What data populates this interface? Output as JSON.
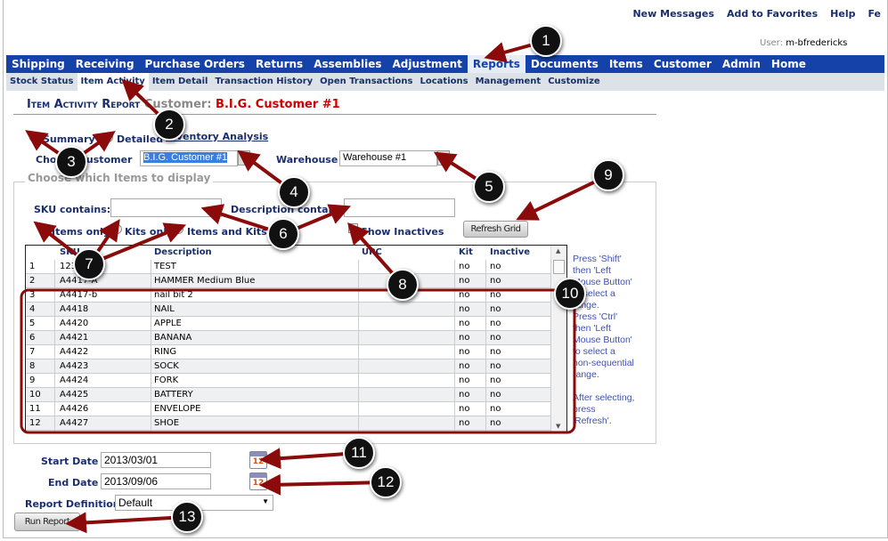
{
  "top_links": [
    "New Messages",
    "Add to Favorites",
    "Help",
    "Fe"
  ],
  "user": {
    "label": "User:",
    "name": "m-bfredericks"
  },
  "nav": [
    "Shipping",
    "Receiving",
    "Purchase Orders",
    "Returns",
    "Assemblies",
    "Adjustment",
    "Reports",
    "Documents",
    "Items",
    "Customer",
    "Admin",
    "Home"
  ],
  "nav_active": "Reports",
  "subnav": [
    "Stock Status",
    "Item Activity",
    "Item Detail",
    "Transaction History",
    "Open Transactions",
    "Locations",
    "Management",
    "Customize"
  ],
  "subnav_active": "Item Activity",
  "title": {
    "main": "Item Activity Report",
    "customer_label": "Customer:",
    "customer_value": "B.I.G. Customer #1"
  },
  "report_type": {
    "summary": "Summary",
    "detailed": "Detailed",
    "selected": "Summary",
    "link": "Inventory Analysis"
  },
  "customer": {
    "label": "Choose Customer",
    "value": "B.I.G. Customer #1"
  },
  "warehouse": {
    "label": "Warehouse",
    "value": "Warehouse #1"
  },
  "items_filter": {
    "legend": "Choose which Items to display",
    "sku_label": "SKU contains:",
    "sku_value": "",
    "desc_label": "Description contains:",
    "desc_value": "",
    "items_only": "Items only",
    "kits_only": "Kits only",
    "items_and_kits": "Items and Kits",
    "selected": "Items only",
    "show_inactives": "Show Inactives",
    "show_inactives_checked": false,
    "refresh": "Refresh Grid"
  },
  "grid": {
    "columns": [
      "SKU",
      "Description",
      "UPC",
      "Kit",
      "Inactive"
    ],
    "rows": [
      [
        "1",
        "123",
        "TEST",
        "",
        "no",
        "no"
      ],
      [
        "2",
        "A4417-A",
        "HAMMER Medium Blue",
        "",
        "no",
        "no"
      ],
      [
        "3",
        "A4417-b",
        "nail bit 2",
        "",
        "no",
        "no"
      ],
      [
        "4",
        "A4418",
        "NAIL",
        "",
        "no",
        "no"
      ],
      [
        "5",
        "A4420",
        "APPLE",
        "",
        "no",
        "no"
      ],
      [
        "6",
        "A4421",
        "BANANA",
        "",
        "no",
        "no"
      ],
      [
        "7",
        "A4422",
        "RING",
        "",
        "no",
        "no"
      ],
      [
        "8",
        "A4423",
        "SOCK",
        "",
        "no",
        "no"
      ],
      [
        "9",
        "A4424",
        "FORK",
        "",
        "no",
        "no"
      ],
      [
        "10",
        "A4425",
        "BATTERY",
        "",
        "no",
        "no"
      ],
      [
        "11",
        "A4426",
        "ENVELOPE",
        "",
        "no",
        "no"
      ],
      [
        "12",
        "A4427",
        "SHOE",
        "",
        "no",
        "no"
      ]
    ]
  },
  "help_text": [
    "Press 'Shift'",
    "then 'Left",
    "Mouse Button'",
    "to select a",
    "range.",
    "Press 'Ctrl'",
    "then 'Left",
    "Mouse Button'",
    "to select a",
    "non-sequential",
    "range.",
    "",
    "After selecting,",
    "press",
    "'Refresh'."
  ],
  "start_date": {
    "label": "Start Date",
    "value": "2013/03/01",
    "calendar_text": "12"
  },
  "end_date": {
    "label": "End Date",
    "value": "2013/09/06",
    "calendar_text": "12"
  },
  "report_definition": {
    "label": "Report Definition",
    "value": "Default"
  },
  "run_report": "Run Report",
  "callouts": [
    "1",
    "2",
    "3",
    "4",
    "5",
    "6",
    "7",
    "8",
    "9",
    "10",
    "11",
    "12",
    "13"
  ],
  "colors": {
    "nav": "#1442a8",
    "annotation": "#8b0a0a",
    "title_customer": "#cc0000"
  }
}
